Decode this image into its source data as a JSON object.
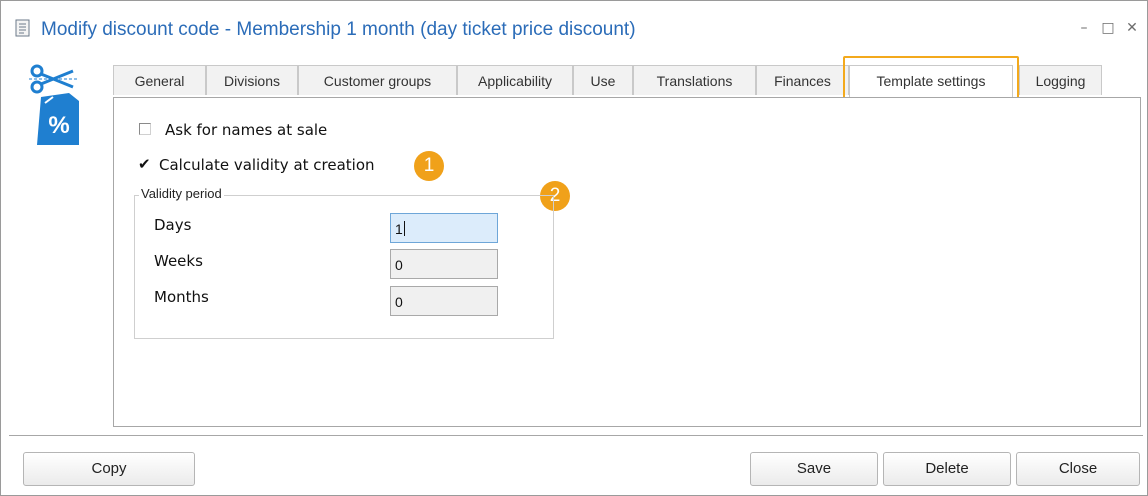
{
  "window": {
    "title": "Modify discount code - Membership 1 month (day ticket price discount)",
    "controls": {
      "minimize": "–",
      "maximize": "□",
      "close": "✕"
    }
  },
  "icons": {
    "title_icon": "form-icon",
    "app_icon": "discount-scissors-percent-icon",
    "app_icon_text": "%"
  },
  "tabs": [
    {
      "label": "General"
    },
    {
      "label": "Divisions"
    },
    {
      "label": "Customer groups"
    },
    {
      "label": "Applicability"
    },
    {
      "label": "Use"
    },
    {
      "label": "Translations"
    },
    {
      "label": "Finances"
    },
    {
      "label": "Template settings",
      "active": true
    },
    {
      "label": "Logging"
    }
  ],
  "template_settings": {
    "ask_names": {
      "label": "Ask for names at sale",
      "checked": false
    },
    "calc_validity": {
      "label": "Calculate validity at creation",
      "checked": true
    },
    "validity_period": {
      "legend": "Validity period",
      "days": {
        "label": "Days",
        "value": "1"
      },
      "weeks": {
        "label": "Weeks",
        "value": "0"
      },
      "months": {
        "label": "Months",
        "value": "0"
      }
    }
  },
  "annotations": {
    "badge1": "1",
    "badge2": "2"
  },
  "buttons": {
    "copy": "Copy",
    "save": "Save",
    "delete": "Delete",
    "close": "Close"
  },
  "colors": {
    "title": "#2b6cb8",
    "highlight": "#f3a91c",
    "badge": "#f0a11a",
    "icon_blue": "#1f7fd0"
  }
}
